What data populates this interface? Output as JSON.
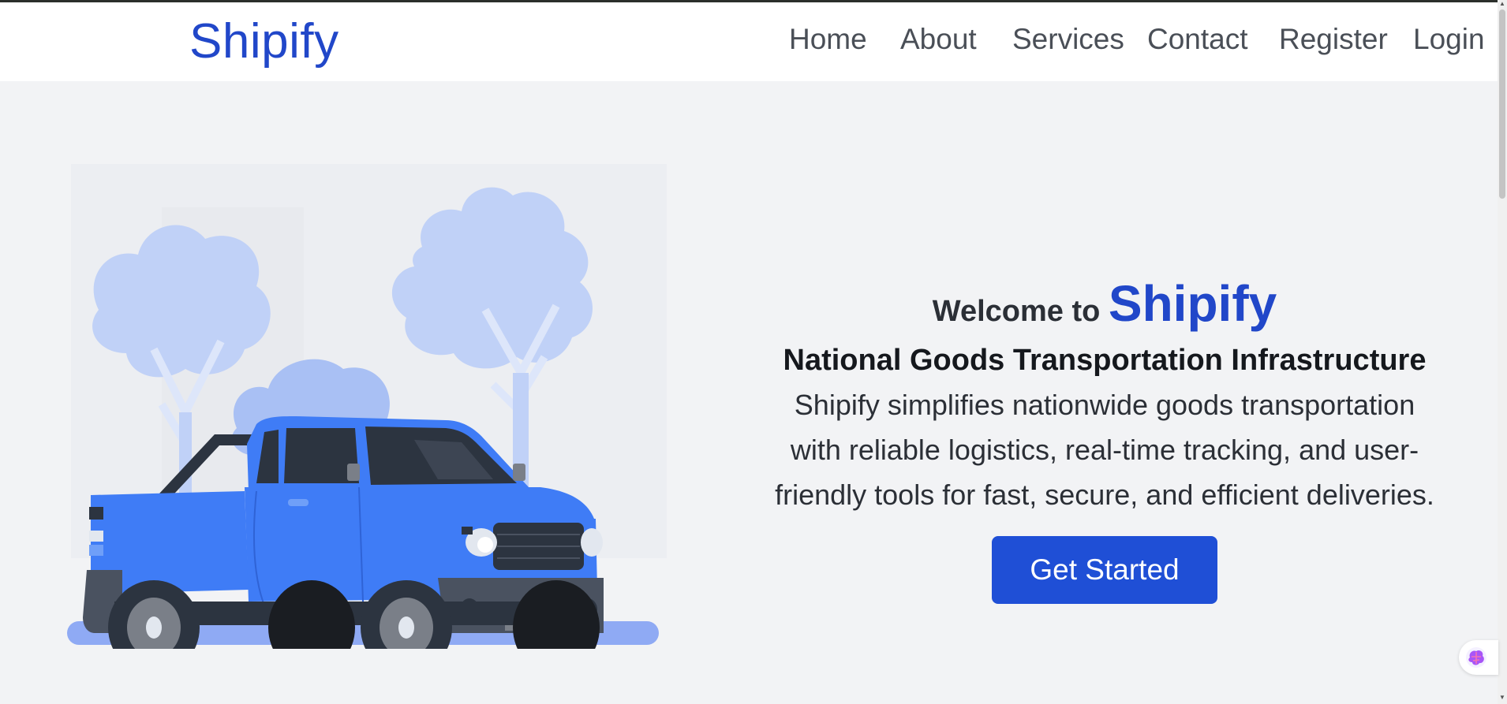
{
  "navbar": {
    "brand": "Shipify",
    "links": [
      {
        "label": "Home"
      },
      {
        "label": "About"
      },
      {
        "label": "Services"
      },
      {
        "label": "Contact"
      },
      {
        "label": "Register"
      },
      {
        "label": "Login"
      }
    ]
  },
  "hero": {
    "welcome_prefix": "Welcome to",
    "welcome_brand": "Shipify",
    "subtitle": "National Goods Transportation Infrastructure",
    "description": "Shipify simplifies nationwide goods transportation with reliable logistics, real-time tracking, and user-friendly tools for fast, secure, and efficient deliveries.",
    "cta_label": "Get Started"
  },
  "illustration": {
    "name": "pickup-truck-illustration",
    "truck_color": "#3f7cf6",
    "tree_color": "#bed0f7"
  },
  "colors": {
    "brand": "#2147c9",
    "button": "#1f4fd6",
    "background": "#f2f3f5"
  },
  "icons": {
    "extension": "brain-extension-icon"
  }
}
